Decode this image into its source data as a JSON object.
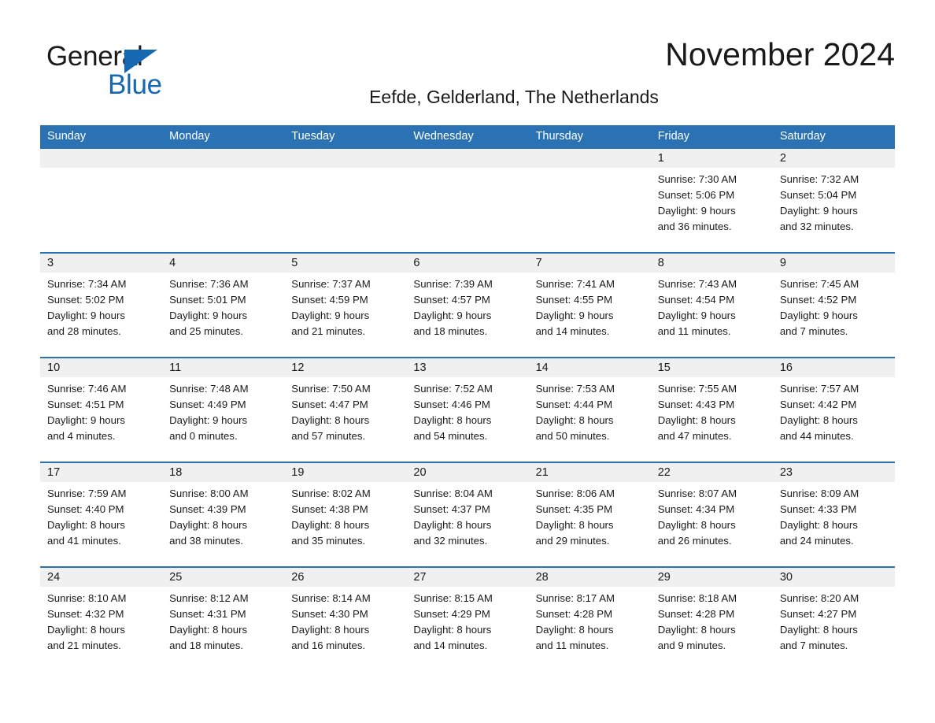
{
  "brand": {
    "name_part1": "General",
    "name_part2": "Blue",
    "triangle_icon": "blue-triangle-icon",
    "accent_color": "#1668b3"
  },
  "header": {
    "month_title": "November 2024",
    "location": "Eefde, Gelderland, The Netherlands"
  },
  "calendar": {
    "header_bg_color": "#2b72b4",
    "date_band_color": "#f0f0f0",
    "day_names": [
      "Sunday",
      "Monday",
      "Tuesday",
      "Wednesday",
      "Thursday",
      "Friday",
      "Saturday"
    ],
    "weeks": [
      [
        {
          "date": "",
          "sunrise": "",
          "sunset": "",
          "daylight_line1": "",
          "daylight_line2": ""
        },
        {
          "date": "",
          "sunrise": "",
          "sunset": "",
          "daylight_line1": "",
          "daylight_line2": ""
        },
        {
          "date": "",
          "sunrise": "",
          "sunset": "",
          "daylight_line1": "",
          "daylight_line2": ""
        },
        {
          "date": "",
          "sunrise": "",
          "sunset": "",
          "daylight_line1": "",
          "daylight_line2": ""
        },
        {
          "date": "",
          "sunrise": "",
          "sunset": "",
          "daylight_line1": "",
          "daylight_line2": ""
        },
        {
          "date": "1",
          "sunrise": "Sunrise: 7:30 AM",
          "sunset": "Sunset: 5:06 PM",
          "daylight_line1": "Daylight: 9 hours",
          "daylight_line2": "and 36 minutes."
        },
        {
          "date": "2",
          "sunrise": "Sunrise: 7:32 AM",
          "sunset": "Sunset: 5:04 PM",
          "daylight_line1": "Daylight: 9 hours",
          "daylight_line2": "and 32 minutes."
        }
      ],
      [
        {
          "date": "3",
          "sunrise": "Sunrise: 7:34 AM",
          "sunset": "Sunset: 5:02 PM",
          "daylight_line1": "Daylight: 9 hours",
          "daylight_line2": "and 28 minutes."
        },
        {
          "date": "4",
          "sunrise": "Sunrise: 7:36 AM",
          "sunset": "Sunset: 5:01 PM",
          "daylight_line1": "Daylight: 9 hours",
          "daylight_line2": "and 25 minutes."
        },
        {
          "date": "5",
          "sunrise": "Sunrise: 7:37 AM",
          "sunset": "Sunset: 4:59 PM",
          "daylight_line1": "Daylight: 9 hours",
          "daylight_line2": "and 21 minutes."
        },
        {
          "date": "6",
          "sunrise": "Sunrise: 7:39 AM",
          "sunset": "Sunset: 4:57 PM",
          "daylight_line1": "Daylight: 9 hours",
          "daylight_line2": "and 18 minutes."
        },
        {
          "date": "7",
          "sunrise": "Sunrise: 7:41 AM",
          "sunset": "Sunset: 4:55 PM",
          "daylight_line1": "Daylight: 9 hours",
          "daylight_line2": "and 14 minutes."
        },
        {
          "date": "8",
          "sunrise": "Sunrise: 7:43 AM",
          "sunset": "Sunset: 4:54 PM",
          "daylight_line1": "Daylight: 9 hours",
          "daylight_line2": "and 11 minutes."
        },
        {
          "date": "9",
          "sunrise": "Sunrise: 7:45 AM",
          "sunset": "Sunset: 4:52 PM",
          "daylight_line1": "Daylight: 9 hours",
          "daylight_line2": "and 7 minutes."
        }
      ],
      [
        {
          "date": "10",
          "sunrise": "Sunrise: 7:46 AM",
          "sunset": "Sunset: 4:51 PM",
          "daylight_line1": "Daylight: 9 hours",
          "daylight_line2": "and 4 minutes."
        },
        {
          "date": "11",
          "sunrise": "Sunrise: 7:48 AM",
          "sunset": "Sunset: 4:49 PM",
          "daylight_line1": "Daylight: 9 hours",
          "daylight_line2": "and 0 minutes."
        },
        {
          "date": "12",
          "sunrise": "Sunrise: 7:50 AM",
          "sunset": "Sunset: 4:47 PM",
          "daylight_line1": "Daylight: 8 hours",
          "daylight_line2": "and 57 minutes."
        },
        {
          "date": "13",
          "sunrise": "Sunrise: 7:52 AM",
          "sunset": "Sunset: 4:46 PM",
          "daylight_line1": "Daylight: 8 hours",
          "daylight_line2": "and 54 minutes."
        },
        {
          "date": "14",
          "sunrise": "Sunrise: 7:53 AM",
          "sunset": "Sunset: 4:44 PM",
          "daylight_line1": "Daylight: 8 hours",
          "daylight_line2": "and 50 minutes."
        },
        {
          "date": "15",
          "sunrise": "Sunrise: 7:55 AM",
          "sunset": "Sunset: 4:43 PM",
          "daylight_line1": "Daylight: 8 hours",
          "daylight_line2": "and 47 minutes."
        },
        {
          "date": "16",
          "sunrise": "Sunrise: 7:57 AM",
          "sunset": "Sunset: 4:42 PM",
          "daylight_line1": "Daylight: 8 hours",
          "daylight_line2": "and 44 minutes."
        }
      ],
      [
        {
          "date": "17",
          "sunrise": "Sunrise: 7:59 AM",
          "sunset": "Sunset: 4:40 PM",
          "daylight_line1": "Daylight: 8 hours",
          "daylight_line2": "and 41 minutes."
        },
        {
          "date": "18",
          "sunrise": "Sunrise: 8:00 AM",
          "sunset": "Sunset: 4:39 PM",
          "daylight_line1": "Daylight: 8 hours",
          "daylight_line2": "and 38 minutes."
        },
        {
          "date": "19",
          "sunrise": "Sunrise: 8:02 AM",
          "sunset": "Sunset: 4:38 PM",
          "daylight_line1": "Daylight: 8 hours",
          "daylight_line2": "and 35 minutes."
        },
        {
          "date": "20",
          "sunrise": "Sunrise: 8:04 AM",
          "sunset": "Sunset: 4:37 PM",
          "daylight_line1": "Daylight: 8 hours",
          "daylight_line2": "and 32 minutes."
        },
        {
          "date": "21",
          "sunrise": "Sunrise: 8:06 AM",
          "sunset": "Sunset: 4:35 PM",
          "daylight_line1": "Daylight: 8 hours",
          "daylight_line2": "and 29 minutes."
        },
        {
          "date": "22",
          "sunrise": "Sunrise: 8:07 AM",
          "sunset": "Sunset: 4:34 PM",
          "daylight_line1": "Daylight: 8 hours",
          "daylight_line2": "and 26 minutes."
        },
        {
          "date": "23",
          "sunrise": "Sunrise: 8:09 AM",
          "sunset": "Sunset: 4:33 PM",
          "daylight_line1": "Daylight: 8 hours",
          "daylight_line2": "and 24 minutes."
        }
      ],
      [
        {
          "date": "24",
          "sunrise": "Sunrise: 8:10 AM",
          "sunset": "Sunset: 4:32 PM",
          "daylight_line1": "Daylight: 8 hours",
          "daylight_line2": "and 21 minutes."
        },
        {
          "date": "25",
          "sunrise": "Sunrise: 8:12 AM",
          "sunset": "Sunset: 4:31 PM",
          "daylight_line1": "Daylight: 8 hours",
          "daylight_line2": "and 18 minutes."
        },
        {
          "date": "26",
          "sunrise": "Sunrise: 8:14 AM",
          "sunset": "Sunset: 4:30 PM",
          "daylight_line1": "Daylight: 8 hours",
          "daylight_line2": "and 16 minutes."
        },
        {
          "date": "27",
          "sunrise": "Sunrise: 8:15 AM",
          "sunset": "Sunset: 4:29 PM",
          "daylight_line1": "Daylight: 8 hours",
          "daylight_line2": "and 14 minutes."
        },
        {
          "date": "28",
          "sunrise": "Sunrise: 8:17 AM",
          "sunset": "Sunset: 4:28 PM",
          "daylight_line1": "Daylight: 8 hours",
          "daylight_line2": "and 11 minutes."
        },
        {
          "date": "29",
          "sunrise": "Sunrise: 8:18 AM",
          "sunset": "Sunset: 4:28 PM",
          "daylight_line1": "Daylight: 8 hours",
          "daylight_line2": "and 9 minutes."
        },
        {
          "date": "30",
          "sunrise": "Sunrise: 8:20 AM",
          "sunset": "Sunset: 4:27 PM",
          "daylight_line1": "Daylight: 8 hours",
          "daylight_line2": "and 7 minutes."
        }
      ]
    ]
  }
}
